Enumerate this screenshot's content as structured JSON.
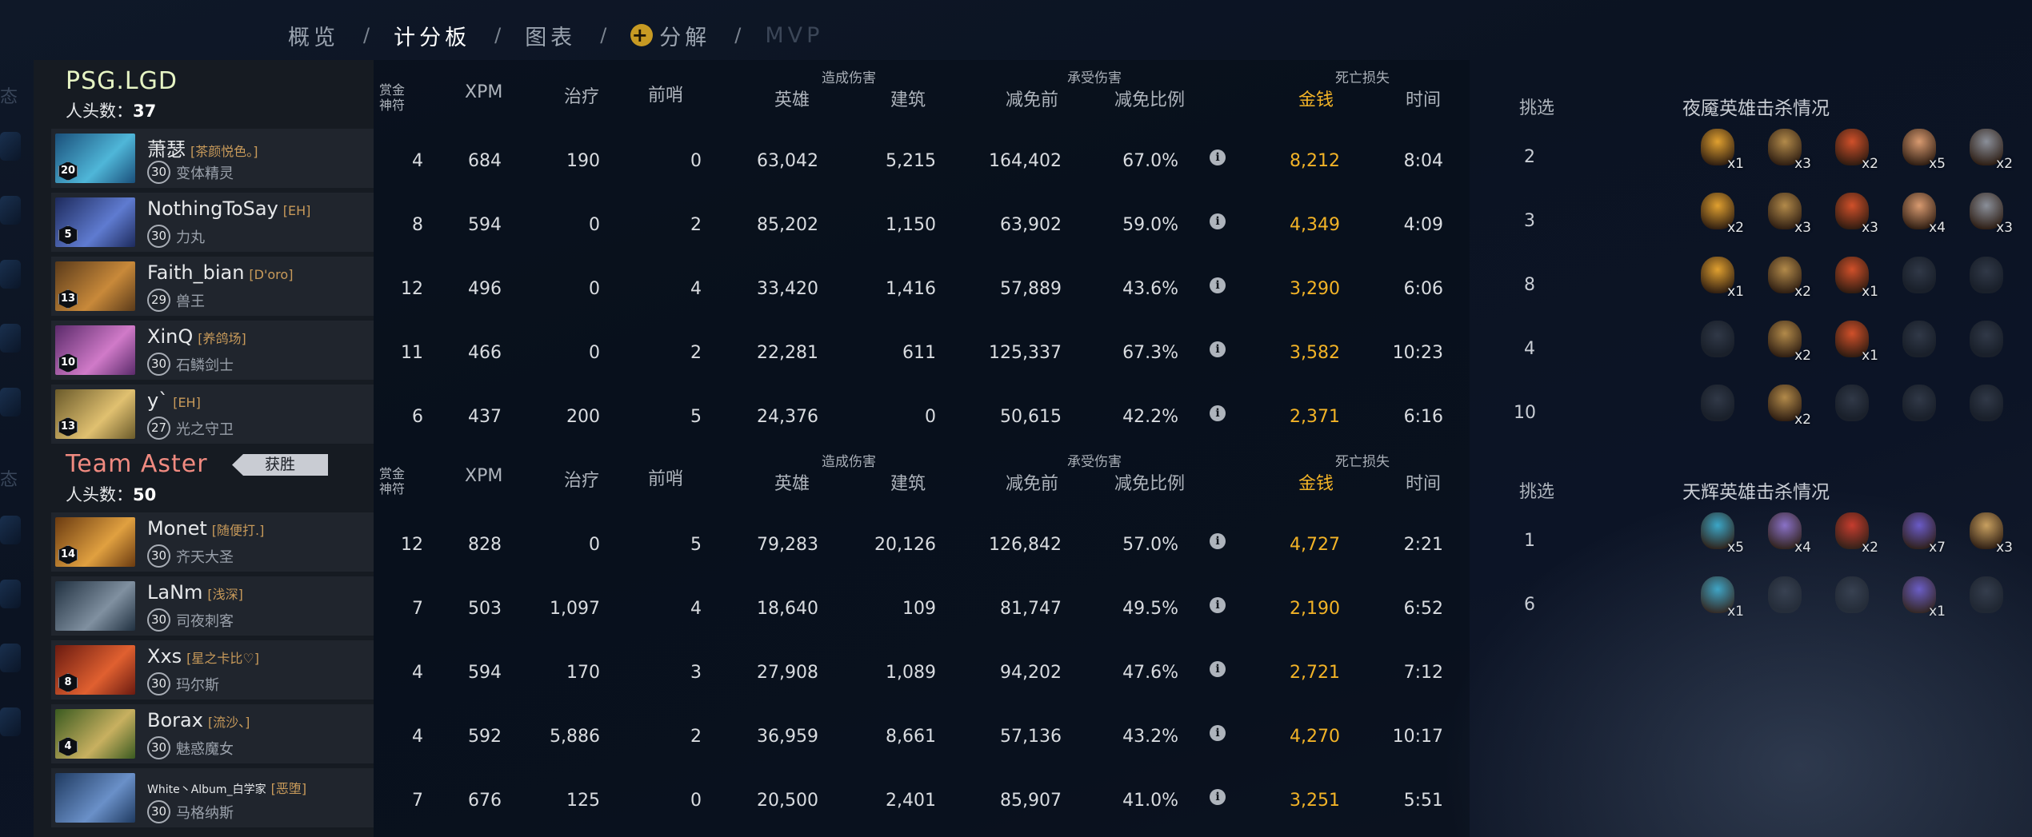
{
  "nav": {
    "items": [
      "概览",
      "计分板",
      "图表",
      "分解",
      "MVP"
    ],
    "separator": "/",
    "active": "计分板",
    "disabled": "MVP"
  },
  "edge": {
    "status_label": "态"
  },
  "headers": {
    "bounty": "赏金神符",
    "xpm": "XPM",
    "heal": "治疗",
    "wards": "前哨",
    "dmg_dealt": "造成伤害",
    "hero": "英雄",
    "building": "建筑",
    "dmg_taken": "承受伤害",
    "before_reduction": "减免前",
    "reduction_pct": "减免比例",
    "death_loss": "死亡损失",
    "gold": "金钱",
    "time": "时间",
    "pick": "挑选"
  },
  "teams": [
    {
      "name": "PSG.LGD",
      "kills_label": "人头数：",
      "kills": "37",
      "kills_panel_title": "夜魇英雄击杀情况",
      "players": [
        {
          "name": "萧瑟",
          "tag": "[茶颜悦色。]",
          "level": "30",
          "hero": "变体精灵",
          "hero_level": "20",
          "bounty": "4",
          "xpm": "684",
          "heal": "190",
          "wards": "0",
          "hero_dmg": "63,042",
          "building_dmg": "5,215",
          "taken": "164,402",
          "reduction": "67.0%",
          "gold_loss": "8,212",
          "time_dead": "8:04",
          "pick": "2"
        },
        {
          "name": "NothingToSay",
          "tag": "[EH]",
          "level": "30",
          "hero": "力丸",
          "hero_level": "5",
          "bounty": "8",
          "xpm": "594",
          "heal": "0",
          "wards": "2",
          "hero_dmg": "85,202",
          "building_dmg": "1,150",
          "taken": "63,902",
          "reduction": "59.0%",
          "gold_loss": "4,349",
          "time_dead": "4:09",
          "pick": "3"
        },
        {
          "name": "Faith_bian",
          "tag": "[D'oro]",
          "level": "29",
          "hero": "兽王",
          "hero_level": "13",
          "bounty": "12",
          "xpm": "496",
          "heal": "0",
          "wards": "4",
          "hero_dmg": "33,420",
          "building_dmg": "1,416",
          "taken": "57,889",
          "reduction": "43.6%",
          "gold_loss": "3,290",
          "time_dead": "6:06",
          "pick": "8"
        },
        {
          "name": "XinQ",
          "tag": "[养鸽场]",
          "level": "30",
          "hero": "石鳞剑士",
          "hero_level": "10",
          "bounty": "11",
          "xpm": "466",
          "heal": "0",
          "wards": "2",
          "hero_dmg": "22,281",
          "building_dmg": "611",
          "taken": "125,337",
          "reduction": "67.3%",
          "gold_loss": "3,582",
          "time_dead": "10:23",
          "pick": "4"
        },
        {
          "name": "y`",
          "tag": "[EH]",
          "level": "27",
          "hero": "光之守卫",
          "hero_level": "13",
          "bounty": "6",
          "xpm": "437",
          "heal": "200",
          "wards": "5",
          "hero_dmg": "24,376",
          "building_dmg": "0",
          "taken": "50,615",
          "reduction": "42.2%",
          "gold_loss": "2,371",
          "time_dead": "6:16",
          "pick": "10"
        }
      ],
      "kill_grid": [
        [
          {
            "count": "x1",
            "color": "#e0a030"
          },
          {
            "count": "x3",
            "color": "#b28a4a"
          },
          {
            "count": "x2",
            "color": "#d0502a"
          },
          {
            "count": "x5",
            "color": "#d89a70"
          },
          {
            "count": "x2",
            "color": "#8a8f99"
          }
        ],
        [
          {
            "count": "x2",
            "color": "#e0a030"
          },
          {
            "count": "x3",
            "color": "#b28a4a"
          },
          {
            "count": "x3",
            "color": "#d0502a"
          },
          {
            "count": "x4",
            "color": "#d89a70"
          },
          {
            "count": "x3",
            "color": "#8a8f99"
          }
        ],
        [
          {
            "count": "x1",
            "color": "#e0a030"
          },
          {
            "count": "x2",
            "color": "#b28a4a"
          },
          {
            "count": "x1",
            "color": "#d0502a"
          },
          {
            "count": "",
            "color": ""
          },
          {
            "count": "",
            "color": ""
          }
        ],
        [
          {
            "count": "",
            "color": ""
          },
          {
            "count": "x2",
            "color": "#b28a4a"
          },
          {
            "count": "x1",
            "color": "#d0502a"
          },
          {
            "count": "",
            "color": ""
          },
          {
            "count": "",
            "color": ""
          }
        ],
        [
          {
            "count": "",
            "color": ""
          },
          {
            "count": "x2",
            "color": "#b28a4a"
          },
          {
            "count": "",
            "color": ""
          },
          {
            "count": "",
            "color": ""
          },
          {
            "count": "",
            "color": ""
          }
        ]
      ]
    },
    {
      "name": "Team Aster",
      "win_badge": "获胜",
      "kills_label": "人头数：",
      "kills": "50",
      "kills_panel_title": "天辉英雄击杀情况",
      "players": [
        {
          "name": "Monet",
          "tag": "[随便打.]",
          "level": "30",
          "hero": "齐天大圣",
          "hero_level": "14",
          "bounty": "12",
          "xpm": "828",
          "heal": "0",
          "wards": "5",
          "hero_dmg": "79,283",
          "building_dmg": "20,126",
          "taken": "126,842",
          "reduction": "57.0%",
          "gold_loss": "4,727",
          "time_dead": "2:21",
          "pick": "1"
        },
        {
          "name": "LaNm",
          "tag": "[浅深]",
          "level": "30",
          "hero": "司夜刺客",
          "hero_level": "",
          "bounty": "7",
          "xpm": "503",
          "heal": "1,097",
          "wards": "4",
          "hero_dmg": "18,640",
          "building_dmg": "109",
          "taken": "81,747",
          "reduction": "49.5%",
          "gold_loss": "2,190",
          "time_dead": "6:52",
          "pick": "6"
        },
        {
          "name": "Xxs",
          "tag": "[星之卡比♡]",
          "level": "30",
          "hero": "玛尔斯",
          "hero_level": "8",
          "bounty": "4",
          "xpm": "594",
          "heal": "170",
          "wards": "3",
          "hero_dmg": "27,908",
          "building_dmg": "1,089",
          "taken": "94,202",
          "reduction": "47.6%",
          "gold_loss": "2,721",
          "time_dead": "7:12",
          "pick": ""
        },
        {
          "name": "Borax",
          "tag": "[流沙、]",
          "level": "30",
          "hero": "魅惑魔女",
          "hero_level": "4",
          "bounty": "4",
          "xpm": "592",
          "heal": "5,886",
          "wards": "2",
          "hero_dmg": "36,959",
          "building_dmg": "8,661",
          "taken": "57,136",
          "reduction": "43.2%",
          "gold_loss": "4,270",
          "time_dead": "10:17",
          "pick": ""
        },
        {
          "name": "White丶Album_白学家",
          "tag": "[恶堕]",
          "level": "30",
          "hero": "马格纳斯",
          "hero_level": "",
          "bounty": "7",
          "xpm": "676",
          "heal": "125",
          "wards": "0",
          "hero_dmg": "20,500",
          "building_dmg": "2,401",
          "taken": "85,907",
          "reduction": "41.0%",
          "gold_loss": "3,251",
          "time_dead": "5:51",
          "pick": ""
        }
      ],
      "kill_grid": [
        [
          {
            "count": "x5",
            "color": "#3aa7c8"
          },
          {
            "count": "x4",
            "color": "#8a70c8"
          },
          {
            "count": "x2",
            "color": "#c83a2a"
          },
          {
            "count": "x7",
            "color": "#6a5ac8"
          },
          {
            "count": "x3",
            "color": "#c8a060"
          }
        ],
        [
          {
            "count": "x1",
            "color": "#3aa7c8"
          },
          {
            "count": "",
            "color": ""
          },
          {
            "count": "",
            "color": ""
          },
          {
            "count": "x1",
            "color": "#6a5ac8"
          },
          {
            "count": "",
            "color": ""
          }
        ]
      ]
    }
  ]
}
